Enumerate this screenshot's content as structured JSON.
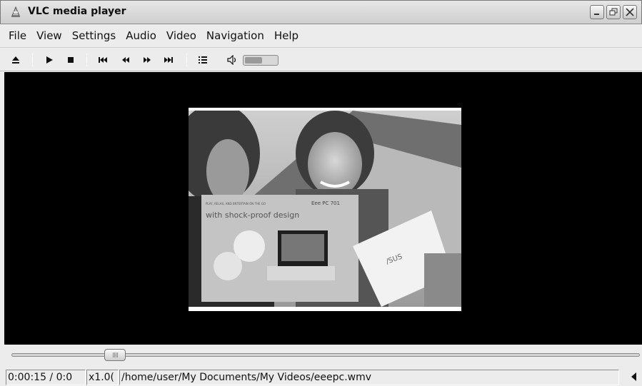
{
  "window": {
    "title": "VLC media player",
    "app_icon": "vlc-cone-icon",
    "controls": [
      "minimize-icon",
      "restore-icon",
      "close-icon"
    ]
  },
  "menu": {
    "items": [
      {
        "label": "File",
        "mnemonic": "F"
      },
      {
        "label": "View",
        "mnemonic": "V"
      },
      {
        "label": "Settings",
        "mnemonic": "S"
      },
      {
        "label": "Audio",
        "mnemonic": "A"
      },
      {
        "label": "Video",
        "mnemonic": "V"
      },
      {
        "label": "Navigation",
        "mnemonic": "N"
      },
      {
        "label": "Help",
        "mnemonic": "H"
      }
    ]
  },
  "toolbar": {
    "buttons": [
      "eject-icon",
      "play-icon",
      "stop-icon",
      "previous-icon",
      "rewind-icon",
      "fast-forward-icon",
      "next-icon",
      "playlist-icon",
      "volume-icon"
    ],
    "volume_level": 0.55
  },
  "video": {
    "frame_texts": {
      "headline": "with shock-proof design",
      "brand": "Eee PC 701",
      "tagline": "PLAY, RELAX, AND ENTERTAIN ON THE GO",
      "laptop_brand": "/SUS"
    }
  },
  "seek": {
    "position_fraction": 0.165
  },
  "status": {
    "time": "0:00:15 / 0:0",
    "speed": "x1.0(",
    "path": "/home/user/My Documents/My Videos/eeepc.wmv",
    "arrow_icon": "left-arrow-icon"
  },
  "colors": {
    "video_background": "#000000",
    "chrome": "#ececec"
  }
}
